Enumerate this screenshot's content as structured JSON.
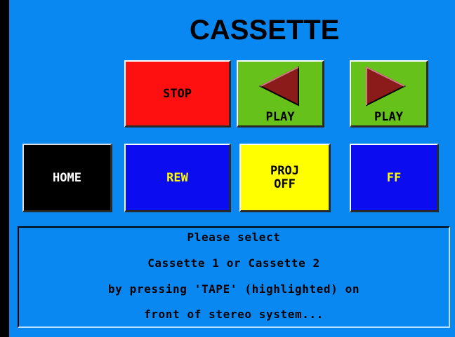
{
  "title": "CASSETTE",
  "buttons": {
    "stop": "STOP",
    "play_reverse": "PLAY",
    "play_forward": "PLAY",
    "home": "HOME",
    "rew": "REW",
    "proj_line1": "PROJ",
    "proj_line2": "OFF",
    "ff": "FF"
  },
  "message": {
    "line1": "Please select",
    "line2": "Cassette 1 or Cassette 2",
    "line3": "by pressing 'TAPE' (highlighted) on",
    "line4": "front of stereo system..."
  },
  "icons": {
    "play_reverse": "triangle-left-icon",
    "play_forward": "triangle-right-icon"
  },
  "colors": {
    "background": "#0a88f2",
    "stop": "#ff1010",
    "play": "#66c21a",
    "home": "#000000",
    "rew_ff": "#0c0cf0",
    "proj": "#ffff00",
    "triangle": "#8b1a1a"
  }
}
